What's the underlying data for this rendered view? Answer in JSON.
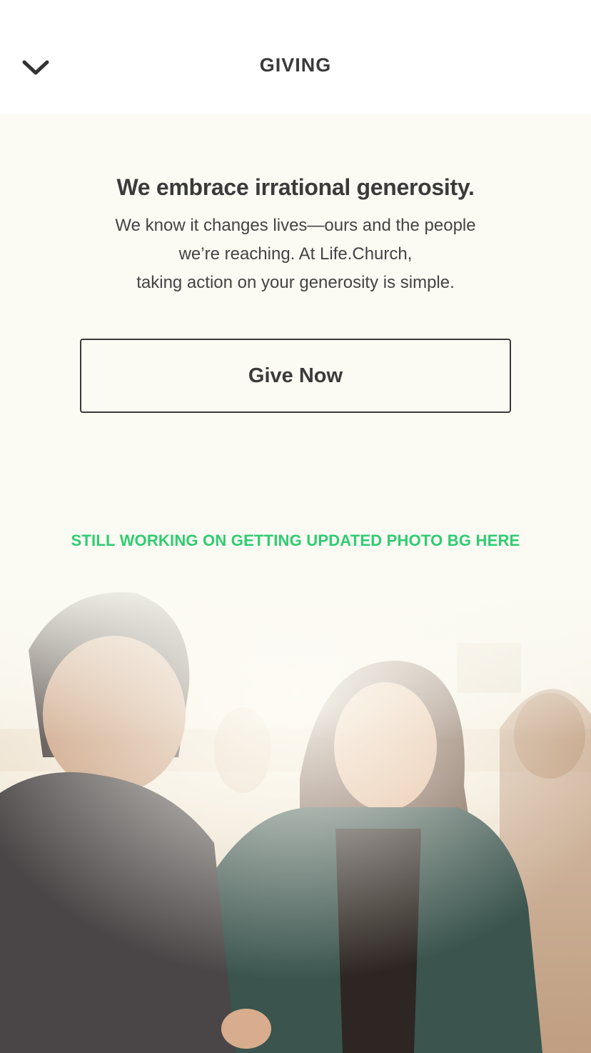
{
  "header": {
    "title": "GIVING",
    "back_icon": "chevron-down-icon"
  },
  "main": {
    "headline": "We embrace irrational generosity.",
    "body_lines": [
      "We know it changes lives—ours and the people",
      "we’re reaching. At Life.Church,",
      "taking action on your generosity is simple."
    ],
    "give_button_label": "Give Now",
    "wip_note": "STILL WORKING ON GETTING UPDATED PHOTO BG HERE"
  },
  "colors": {
    "background": "#fbfaf3",
    "header_bg": "#ffffff",
    "text": "#3c3c3c",
    "accent_green": "#2ecc71"
  }
}
